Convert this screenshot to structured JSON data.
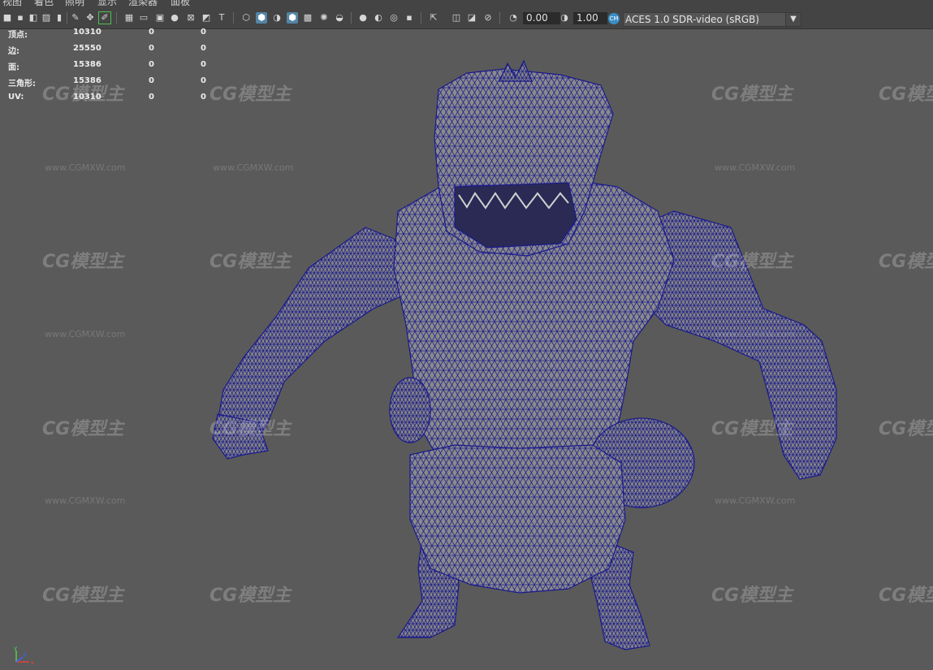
{
  "menu": {
    "items": [
      "视图",
      "着色",
      "照明",
      "显示",
      "渲染器",
      "面板"
    ]
  },
  "toolbar": {
    "field1": "0.00",
    "field2": "1.00",
    "colorspace": "ACES 1.0 SDR-video (sRGB)",
    "colorspace_badge": "CM"
  },
  "hud": {
    "rows": [
      {
        "label": "顶点:",
        "v1": "10310",
        "v2": "0",
        "v3": "0"
      },
      {
        "label": "边:",
        "v1": "25550",
        "v2": "0",
        "v3": "0"
      },
      {
        "label": "面:",
        "v1": "15386",
        "v2": "0",
        "v3": "0"
      },
      {
        "label": "三角形:",
        "v1": "15386",
        "v2": "0",
        "v3": "0"
      },
      {
        "label": "UV:",
        "v1": "10310",
        "v2": "0",
        "v3": "0"
      }
    ]
  },
  "watermark": {
    "logo": "CG模型主",
    "url": "www.CGMXW.com"
  },
  "axis": {
    "y": "y",
    "x": "x",
    "z": "z"
  },
  "colors": {
    "wire": "#1a1a8c",
    "mesh": "#888888",
    "viewport": "#5a5a5a",
    "toolbar": "#444444",
    "accent": "#5285a6"
  }
}
